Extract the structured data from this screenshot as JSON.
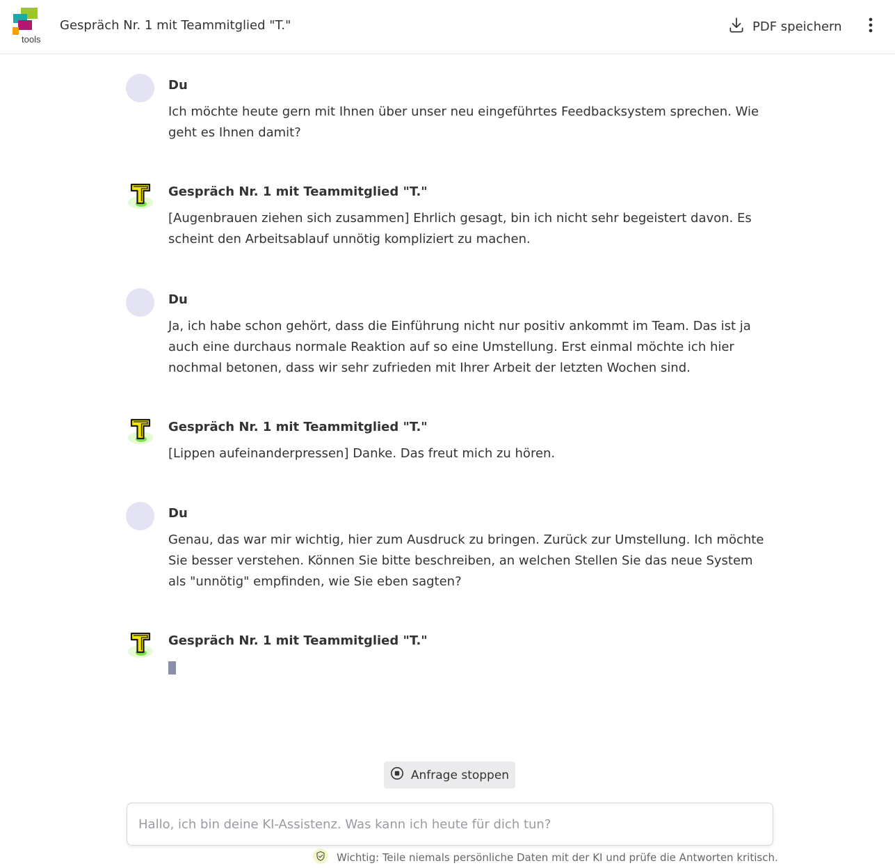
{
  "header": {
    "logo_text": "tools",
    "title": "Gespräch Nr. 1 mit Teammitglied \"T.\"",
    "pdf_label": "PDF speichern",
    "download_icon": "download-icon",
    "menu_icon": "more-vertical-icon"
  },
  "messages": [
    {
      "author": "Du",
      "role": "user",
      "text": "Ich möchte heute gern mit Ihnen über unser neu eingeführtes Feedbacksystem sprechen. Wie geht es Ihnen damit?"
    },
    {
      "author": "Gespräch Nr. 1 mit Teammitglied \"T.\"",
      "role": "assistant",
      "text": "[Augenbrauen ziehen sich zusammen] Ehrlich gesagt, bin ich nicht sehr begeistert davon. Es scheint den Arbeitsablauf unnötig kompliziert zu machen."
    },
    {
      "author": "Du",
      "role": "user",
      "text": "Ja, ich habe schon gehört, dass die Einführung nicht nur positiv ankommt im Team. Das ist ja auch eine durchaus normale Reaktion auf so eine Umstellung. Erst einmal möchte ich hier nochmal betonen, dass wir sehr zufrieden mit Ihrer Arbeit der letzten Wochen sind."
    },
    {
      "author": "Gespräch Nr. 1 mit Teammitglied \"T.\"",
      "role": "assistant",
      "text": "[Lippen aufeinanderpressen] Danke. Das freut mich zu hören."
    },
    {
      "author": "Du",
      "role": "user",
      "text": "Genau, das war mir wichtig, hier zum Ausdruck zu bringen. Zurück zur Umstellung. Ich möchte Sie besser verstehen. Können Sie bitte beschreiben, an welchen Stellen Sie das neue System als \"unnötig\" empfinden, wie Sie eben sagten?"
    },
    {
      "author": "Gespräch Nr. 1 mit Teammitglied \"T.\"",
      "role": "assistant",
      "text": ""
    }
  ],
  "stop_button": {
    "label": "Anfrage stoppen",
    "icon": "stop-circle-icon"
  },
  "input": {
    "placeholder": "Hallo, ich bin deine KI-Assistenz. Was kann ich heute für dich tun?",
    "value": ""
  },
  "disclaimer": {
    "icon": "shield-check-icon",
    "text": "Wichtig: Teile niemals persönliche Daten mit der KI und prüfe die Antworten kritisch."
  },
  "colors": {
    "user_avatar": "#e3e3f4",
    "assistant_avatar_letter": "#f2e600",
    "assistant_avatar_glow": "#7fe34b",
    "logo_green": "#9dc823",
    "logo_teal": "#1fa9a6",
    "logo_magenta": "#b2186f",
    "logo_orange": "#f4a100",
    "cursor": "#8c8fa8"
  }
}
